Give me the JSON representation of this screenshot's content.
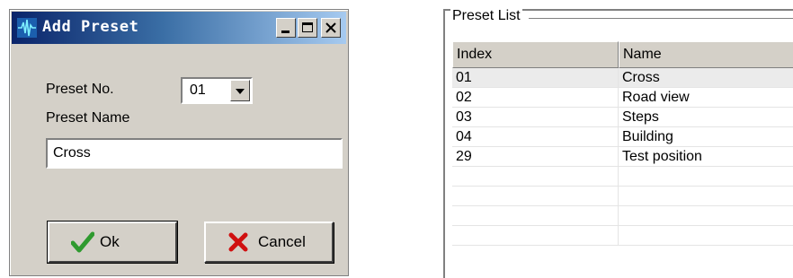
{
  "dialog": {
    "title": "Add Preset",
    "preset_no_label": "Preset No.",
    "preset_no_value": "01",
    "preset_name_label": "Preset Name",
    "preset_name_value": "Cross",
    "ok_label": "Ok",
    "cancel_label": "Cancel",
    "icons": {
      "app": "waveform-icon",
      "ok": "checkmark-icon",
      "cancel": "x-icon"
    },
    "colors": {
      "titlebar_start": "#0a246a",
      "titlebar_end": "#a6caf0",
      "ok_check": "#2f9a2f",
      "cancel_x": "#d01010"
    }
  },
  "preset_list": {
    "caption": "Preset List",
    "columns": [
      "Index",
      "Name"
    ],
    "rows": [
      {
        "index": "01",
        "name": "Cross",
        "selected": true
      },
      {
        "index": "02",
        "name": "Road view"
      },
      {
        "index": "03",
        "name": "Steps"
      },
      {
        "index": "04",
        "name": "Building"
      },
      {
        "index": "29",
        "name": "Test position"
      },
      {
        "index": "",
        "name": ""
      },
      {
        "index": "",
        "name": ""
      },
      {
        "index": "",
        "name": ""
      },
      {
        "index": "",
        "name": ""
      }
    ]
  }
}
